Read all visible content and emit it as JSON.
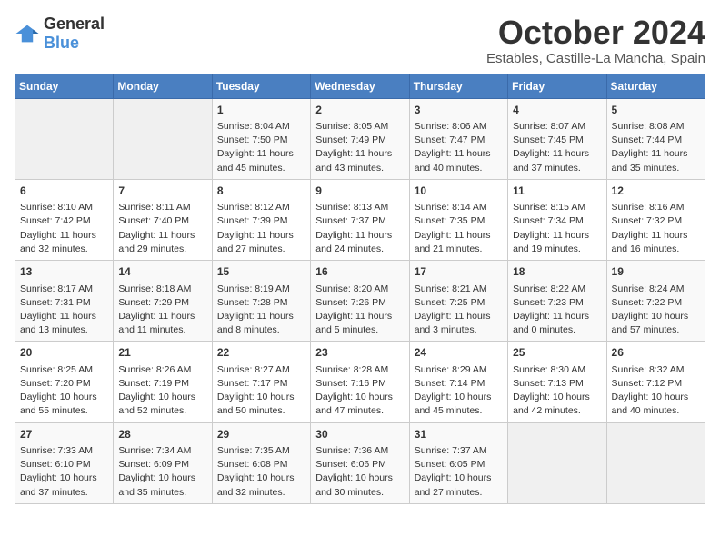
{
  "header": {
    "logo_general": "General",
    "logo_blue": "Blue",
    "month_title": "October 2024",
    "location": "Estables, Castille-La Mancha, Spain"
  },
  "weekdays": [
    "Sunday",
    "Monday",
    "Tuesday",
    "Wednesday",
    "Thursday",
    "Friday",
    "Saturday"
  ],
  "weeks": [
    [
      {
        "day": "",
        "info": ""
      },
      {
        "day": "",
        "info": ""
      },
      {
        "day": "1",
        "info": "Sunrise: 8:04 AM\nSunset: 7:50 PM\nDaylight: 11 hours and 45 minutes."
      },
      {
        "day": "2",
        "info": "Sunrise: 8:05 AM\nSunset: 7:49 PM\nDaylight: 11 hours and 43 minutes."
      },
      {
        "day": "3",
        "info": "Sunrise: 8:06 AM\nSunset: 7:47 PM\nDaylight: 11 hours and 40 minutes."
      },
      {
        "day": "4",
        "info": "Sunrise: 8:07 AM\nSunset: 7:45 PM\nDaylight: 11 hours and 37 minutes."
      },
      {
        "day": "5",
        "info": "Sunrise: 8:08 AM\nSunset: 7:44 PM\nDaylight: 11 hours and 35 minutes."
      }
    ],
    [
      {
        "day": "6",
        "info": "Sunrise: 8:10 AM\nSunset: 7:42 PM\nDaylight: 11 hours and 32 minutes."
      },
      {
        "day": "7",
        "info": "Sunrise: 8:11 AM\nSunset: 7:40 PM\nDaylight: 11 hours and 29 minutes."
      },
      {
        "day": "8",
        "info": "Sunrise: 8:12 AM\nSunset: 7:39 PM\nDaylight: 11 hours and 27 minutes."
      },
      {
        "day": "9",
        "info": "Sunrise: 8:13 AM\nSunset: 7:37 PM\nDaylight: 11 hours and 24 minutes."
      },
      {
        "day": "10",
        "info": "Sunrise: 8:14 AM\nSunset: 7:35 PM\nDaylight: 11 hours and 21 minutes."
      },
      {
        "day": "11",
        "info": "Sunrise: 8:15 AM\nSunset: 7:34 PM\nDaylight: 11 hours and 19 minutes."
      },
      {
        "day": "12",
        "info": "Sunrise: 8:16 AM\nSunset: 7:32 PM\nDaylight: 11 hours and 16 minutes."
      }
    ],
    [
      {
        "day": "13",
        "info": "Sunrise: 8:17 AM\nSunset: 7:31 PM\nDaylight: 11 hours and 13 minutes."
      },
      {
        "day": "14",
        "info": "Sunrise: 8:18 AM\nSunset: 7:29 PM\nDaylight: 11 hours and 11 minutes."
      },
      {
        "day": "15",
        "info": "Sunrise: 8:19 AM\nSunset: 7:28 PM\nDaylight: 11 hours and 8 minutes."
      },
      {
        "day": "16",
        "info": "Sunrise: 8:20 AM\nSunset: 7:26 PM\nDaylight: 11 hours and 5 minutes."
      },
      {
        "day": "17",
        "info": "Sunrise: 8:21 AM\nSunset: 7:25 PM\nDaylight: 11 hours and 3 minutes."
      },
      {
        "day": "18",
        "info": "Sunrise: 8:22 AM\nSunset: 7:23 PM\nDaylight: 11 hours and 0 minutes."
      },
      {
        "day": "19",
        "info": "Sunrise: 8:24 AM\nSunset: 7:22 PM\nDaylight: 10 hours and 57 minutes."
      }
    ],
    [
      {
        "day": "20",
        "info": "Sunrise: 8:25 AM\nSunset: 7:20 PM\nDaylight: 10 hours and 55 minutes."
      },
      {
        "day": "21",
        "info": "Sunrise: 8:26 AM\nSunset: 7:19 PM\nDaylight: 10 hours and 52 minutes."
      },
      {
        "day": "22",
        "info": "Sunrise: 8:27 AM\nSunset: 7:17 PM\nDaylight: 10 hours and 50 minutes."
      },
      {
        "day": "23",
        "info": "Sunrise: 8:28 AM\nSunset: 7:16 PM\nDaylight: 10 hours and 47 minutes."
      },
      {
        "day": "24",
        "info": "Sunrise: 8:29 AM\nSunset: 7:14 PM\nDaylight: 10 hours and 45 minutes."
      },
      {
        "day": "25",
        "info": "Sunrise: 8:30 AM\nSunset: 7:13 PM\nDaylight: 10 hours and 42 minutes."
      },
      {
        "day": "26",
        "info": "Sunrise: 8:32 AM\nSunset: 7:12 PM\nDaylight: 10 hours and 40 minutes."
      }
    ],
    [
      {
        "day": "27",
        "info": "Sunrise: 7:33 AM\nSunset: 6:10 PM\nDaylight: 10 hours and 37 minutes."
      },
      {
        "day": "28",
        "info": "Sunrise: 7:34 AM\nSunset: 6:09 PM\nDaylight: 10 hours and 35 minutes."
      },
      {
        "day": "29",
        "info": "Sunrise: 7:35 AM\nSunset: 6:08 PM\nDaylight: 10 hours and 32 minutes."
      },
      {
        "day": "30",
        "info": "Sunrise: 7:36 AM\nSunset: 6:06 PM\nDaylight: 10 hours and 30 minutes."
      },
      {
        "day": "31",
        "info": "Sunrise: 7:37 AM\nSunset: 6:05 PM\nDaylight: 10 hours and 27 minutes."
      },
      {
        "day": "",
        "info": ""
      },
      {
        "day": "",
        "info": ""
      }
    ]
  ]
}
